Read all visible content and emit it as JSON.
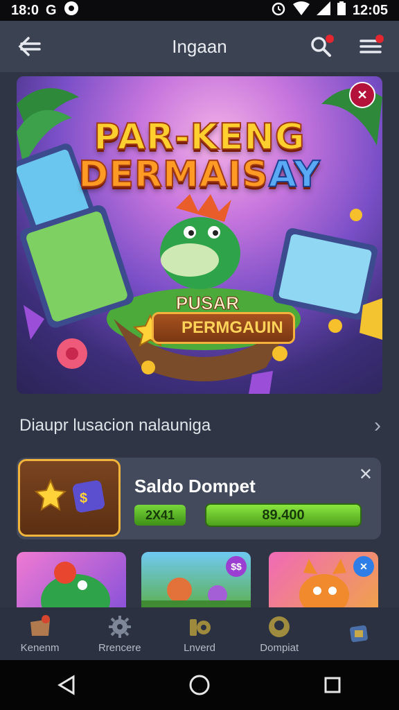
{
  "status_bar": {
    "time": "18:0",
    "right_time": "12:05",
    "icons": [
      "alarm-icon",
      "wifi-icon",
      "signal-icon",
      "battery-icon"
    ]
  },
  "header": {
    "title": "Ingaan",
    "back_icon": "back-arrow-icon",
    "search_icon": "search-icon",
    "menu_icon": "menu-icon"
  },
  "banner": {
    "title_line1": "PAR-KENG",
    "title_line2_main": "DERMAIS",
    "title_line2_tail": "AY",
    "subtitle_small": "PUSAR",
    "subtitle_badge": "PERMGAUIN",
    "corner_badge": "✕"
  },
  "section": {
    "title": "Diaupr lusacion nalauniga"
  },
  "wallet": {
    "title": "Saldo Dompet",
    "small_value": "2X41",
    "amount": "89.400"
  },
  "tiles": [
    {
      "badge": ""
    },
    {
      "badge": "$$"
    },
    {
      "badge": "✕"
    }
  ],
  "bottom_nav": [
    {
      "label": "Kenenm",
      "icon": "shop-icon"
    },
    {
      "label": "Rrencere",
      "icon": "gear-icon"
    },
    {
      "label": "Lnverd",
      "icon": "reward-icon"
    },
    {
      "label": "Dompiat",
      "icon": "wallet-icon"
    },
    {
      "label": "",
      "icon": "gift-icon"
    }
  ],
  "colors": {
    "accent_green": "#6ccf2e",
    "notification_red": "#e3262f",
    "header_bg": "#3b4252"
  }
}
